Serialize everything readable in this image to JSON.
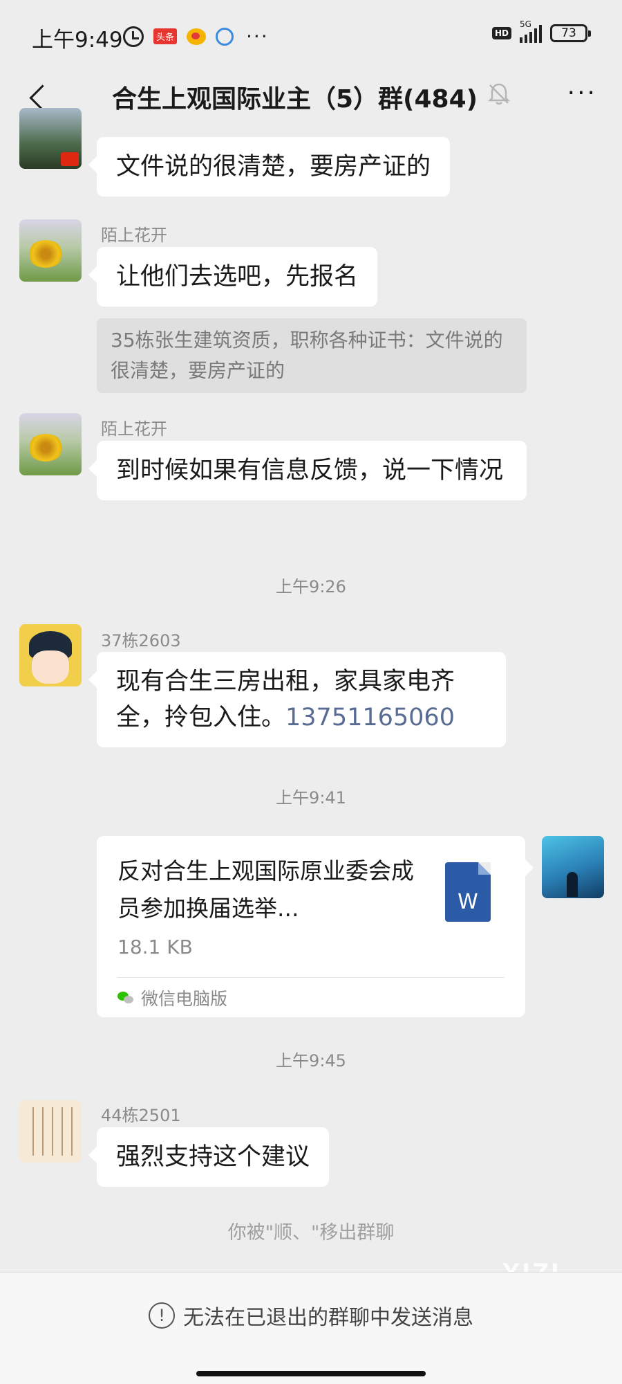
{
  "status_bar": {
    "time": "上午9:49",
    "notification_badge": "头条",
    "more": "···",
    "hd": "HD",
    "network": "5G",
    "battery": "73"
  },
  "nav": {
    "title": "合生上观国际业主（5）群(484)",
    "more": "···"
  },
  "messages": [
    {
      "text": "文件说的很清楚，要房产证的"
    },
    {
      "sender": "陌上花开",
      "text": "让他们去选吧，先报名",
      "quote": "35栋张生建筑资质，职称各种证书：文件说的很清楚，要房产证的"
    },
    {
      "sender": "陌上花开",
      "text": "到时候如果有信息反馈，说一下情况"
    },
    {
      "time": "上午9:26"
    },
    {
      "sender": "37栋2603",
      "text": "现有合生三房出租，家具家电齐全，拎包入住。",
      "phone": "13751165060"
    },
    {
      "time": "上午9:41"
    },
    {
      "file": {
        "name": "反对合生上观国际原业委会成员参加换届选举...",
        "size": "18.1 KB",
        "icon_letter": "W",
        "source": "微信电脑版"
      }
    },
    {
      "time": "上午9:45"
    },
    {
      "sender": "44栋2501",
      "text": "强烈支持这个建议"
    }
  ],
  "system_message": "你被\"顺、\"移出群聊",
  "watermark": "XIZI",
  "bottom_notice": {
    "icon": "!",
    "text": "无法在已退出的群聊中发送消息"
  }
}
